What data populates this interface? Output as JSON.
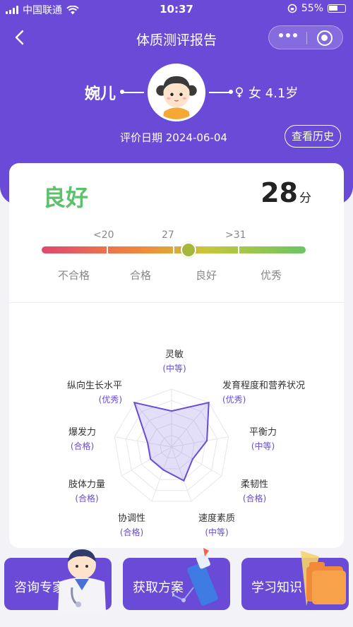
{
  "status_bar": {
    "carrier": "中国联通",
    "time": "10:37",
    "battery": "55%",
    "battery_level": 0.55
  },
  "nav": {
    "title": "体质测评报告"
  },
  "profile": {
    "name": "婉儿",
    "gender_age": "女 4.1岁",
    "eval_date": "评价日期 2024-06-04",
    "history_button": "查看历史"
  },
  "result": {
    "level": "良好",
    "score": "28",
    "score_unit": "分",
    "score_value": 28,
    "ticks": [
      "<20",
      "27",
      ">31"
    ],
    "grades": [
      "不合格",
      "合格",
      "良好",
      "优秀"
    ]
  },
  "radar": {
    "axes": [
      {
        "label": "灵敏",
        "value": "(中等)"
      },
      {
        "label": "发育程度和营养状况",
        "value": "(优秀)"
      },
      {
        "label": "平衡力",
        "value": "(中等)"
      },
      {
        "label": "柔韧性",
        "value": "(合格)"
      },
      {
        "label": "速度素质",
        "value": "(中等)"
      },
      {
        "label": "协调性",
        "value": "(合格)"
      },
      {
        "label": "肢体力量",
        "value": "(合格)"
      },
      {
        "label": "爆发力",
        "value": "(合格)"
      },
      {
        "label": "纵向生长水平",
        "value": "(优秀)"
      }
    ]
  },
  "bottom_buttons": [
    {
      "label": "咨询专家",
      "icon": "doctor-icon"
    },
    {
      "label": "获取方案",
      "icon": "chart-tools-icon"
    },
    {
      "label": "学习知识",
      "icon": "folder-icon"
    }
  ],
  "colors": {
    "primary": "#6a4bd8",
    "good": "#5cc16a"
  }
}
